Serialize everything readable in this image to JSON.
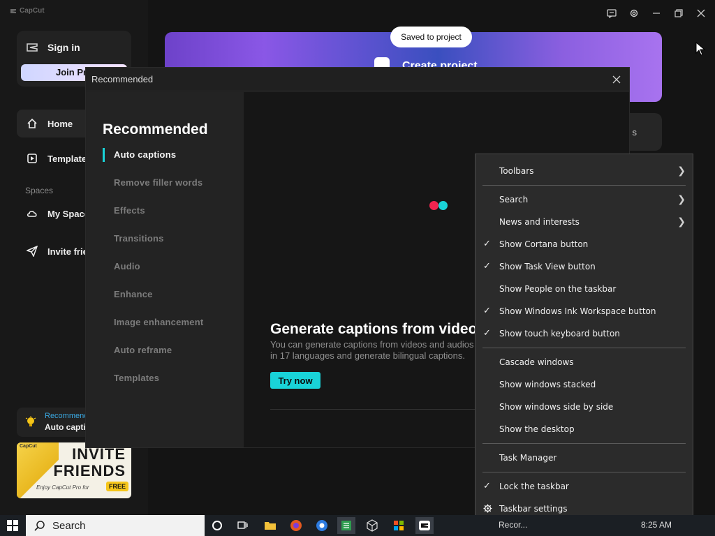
{
  "app": {
    "logo": "CapCut",
    "toast": "Saved to project",
    "sidebar": {
      "sign_in": "Sign in",
      "join_pro": "Join Pro",
      "nav": [
        {
          "label": "Home"
        },
        {
          "label": "Templates"
        }
      ],
      "spaces_heading": "Spaces",
      "my_space": "My Space",
      "invite": "Invite friends",
      "promo_title": "Recommended",
      "promo_item": "Auto captions",
      "invite_card": {
        "brand": "CapCut",
        "line1": "INVITE",
        "line2": "FRIENDS",
        "sub": "Enjoy CapCut Pro for",
        "free": "FREE"
      }
    },
    "banner": {
      "title": "Create project"
    },
    "window_controls": [
      "feedback",
      "settings",
      "minimize",
      "restore",
      "close"
    ]
  },
  "dialog": {
    "title": "Recommended",
    "heading": "Recommended",
    "menu": [
      "Auto captions",
      "Remove filler words",
      "Effects",
      "Transitions",
      "Audio",
      "Enhance",
      "Image enhancement",
      "Auto reframe",
      "Templates"
    ],
    "active_index": 0,
    "feature": {
      "title": "Generate captions from videos",
      "description": "You can generate captions from videos and audios in 17 languages and generate bilingual captions.",
      "button": "Try now"
    }
  },
  "context_menu": {
    "groups": [
      [
        {
          "label": "Toolbars",
          "submenu": true
        }
      ],
      [
        {
          "label": "Search",
          "submenu": true
        },
        {
          "label": "News and interests",
          "submenu": true
        },
        {
          "label": "Show Cortana button",
          "checked": true
        },
        {
          "label": "Show Task View button",
          "checked": true
        },
        {
          "label": "Show People on the taskbar"
        },
        {
          "label": "Show Windows Ink Workspace button",
          "checked": true
        },
        {
          "label": "Show touch keyboard button",
          "checked": true
        }
      ],
      [
        {
          "label": "Cascade windows"
        },
        {
          "label": "Show windows stacked"
        },
        {
          "label": "Show windows side by side"
        },
        {
          "label": "Show the desktop"
        }
      ],
      [
        {
          "label": "Task Manager"
        }
      ],
      [
        {
          "label": "Lock the taskbar",
          "checked": true
        },
        {
          "label": "Taskbar settings",
          "icon": "gear-icon"
        }
      ]
    ]
  },
  "taskbar": {
    "search_label": "Search",
    "tray_app_label": "Recor...",
    "clock": "8:25 AM"
  },
  "colors": {
    "accent": "#19d3d8",
    "loader_red": "#f0244f",
    "loader_cyan": "#19d3d8"
  }
}
